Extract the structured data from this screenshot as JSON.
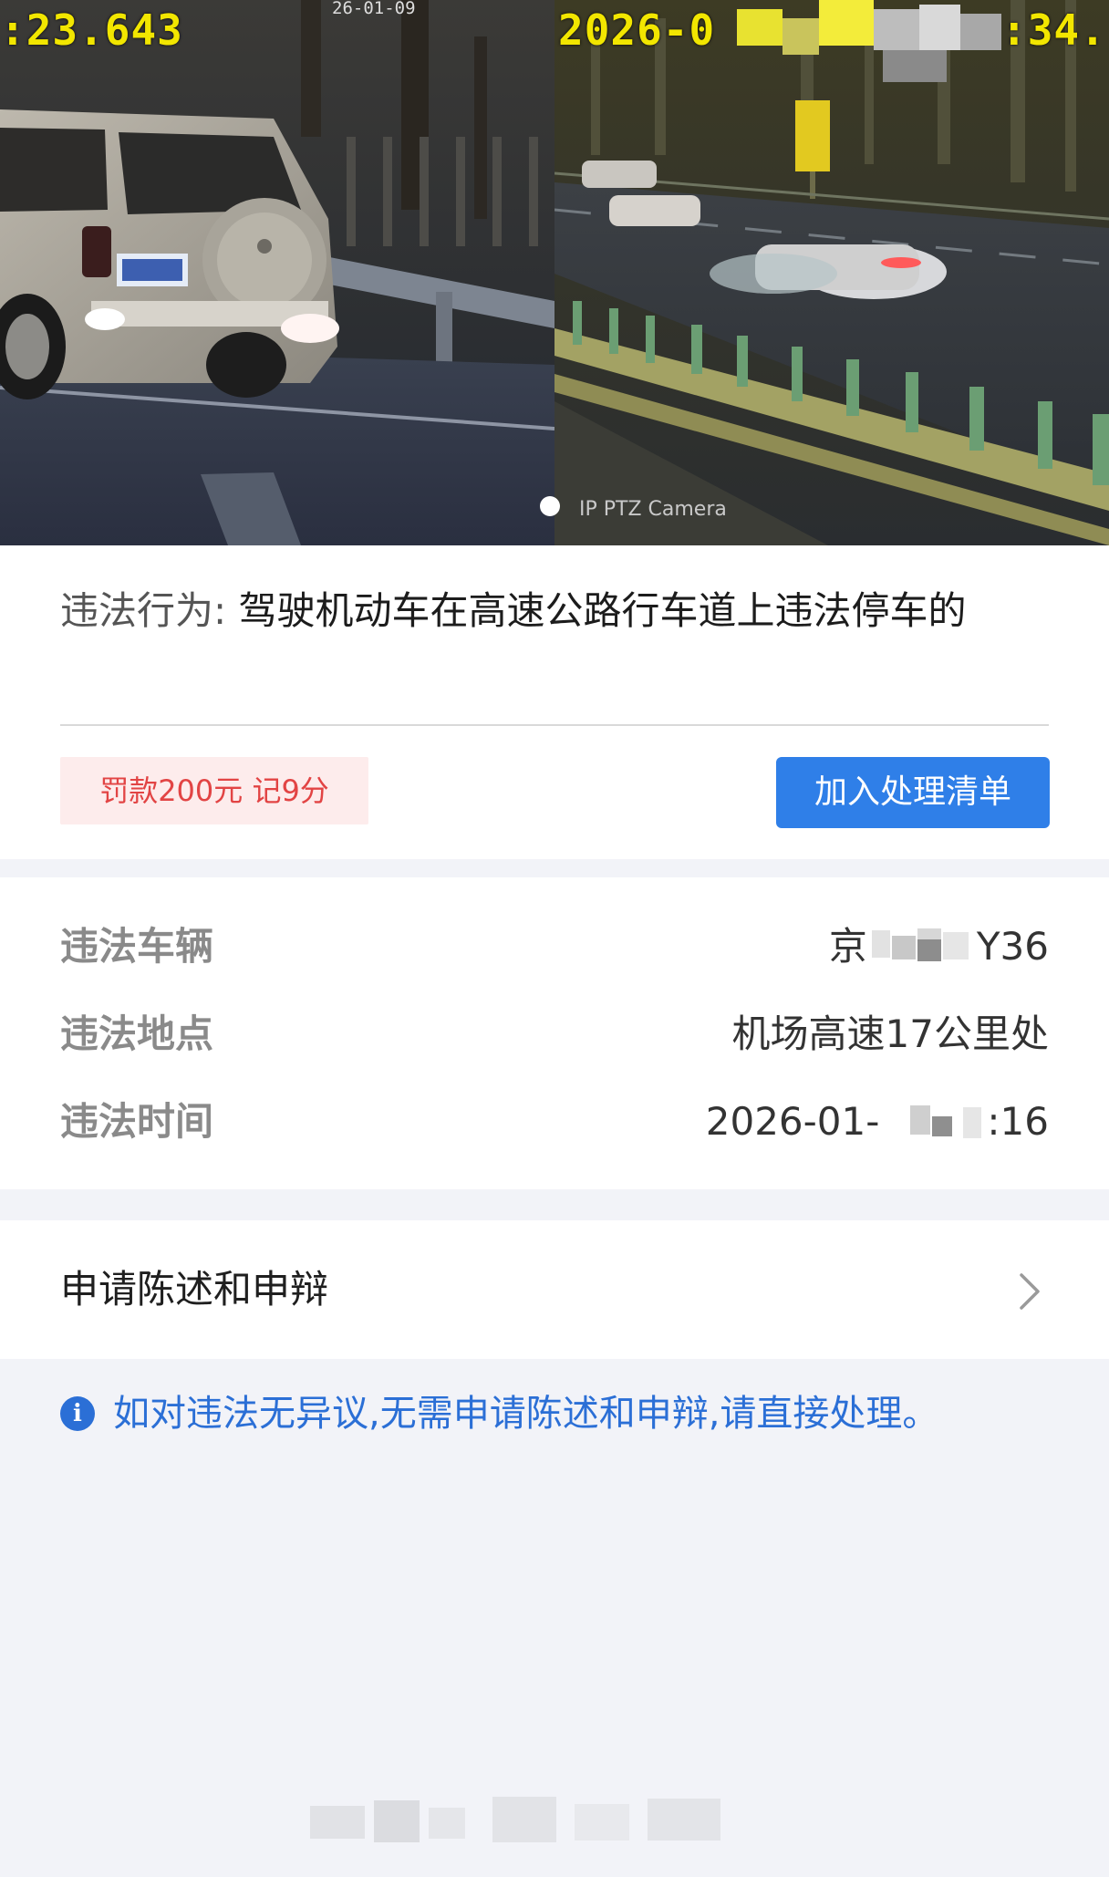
{
  "photos": {
    "left_timestamp": ":23.643",
    "left_small_timestamp": "26-01-09",
    "right_timestamp_start": "2026-0",
    "right_timestamp_end": ":34.",
    "camera_label": "IP PTZ Camera"
  },
  "violation": {
    "label": "违法行为:",
    "description": "驾驶机动车在高速公路行车道上违法停车的",
    "penalty": "罚款200元 记9分",
    "add_button": "加入处理清单"
  },
  "details": {
    "vehicle_label": "违法车辆",
    "vehicle_value_start": "京",
    "vehicle_value_end": "Y36",
    "location_label": "违法地点",
    "location_value": "机场高速17公里处",
    "time_label": "违法时间",
    "time_value_start": "2026-01-",
    "time_value_end": ":16"
  },
  "appeal": {
    "label": "申请陈述和申辩"
  },
  "notice": {
    "icon": "info-icon",
    "text": "如对违法无异议,无需申请陈述和申辩,请直接处理。"
  },
  "colors": {
    "accent": "#2f7fe8",
    "notice_blue": "#2b6fd6",
    "penalty_red": "#e24444",
    "penalty_bg": "#fdecec",
    "page_bg": "#f2f3f8"
  }
}
